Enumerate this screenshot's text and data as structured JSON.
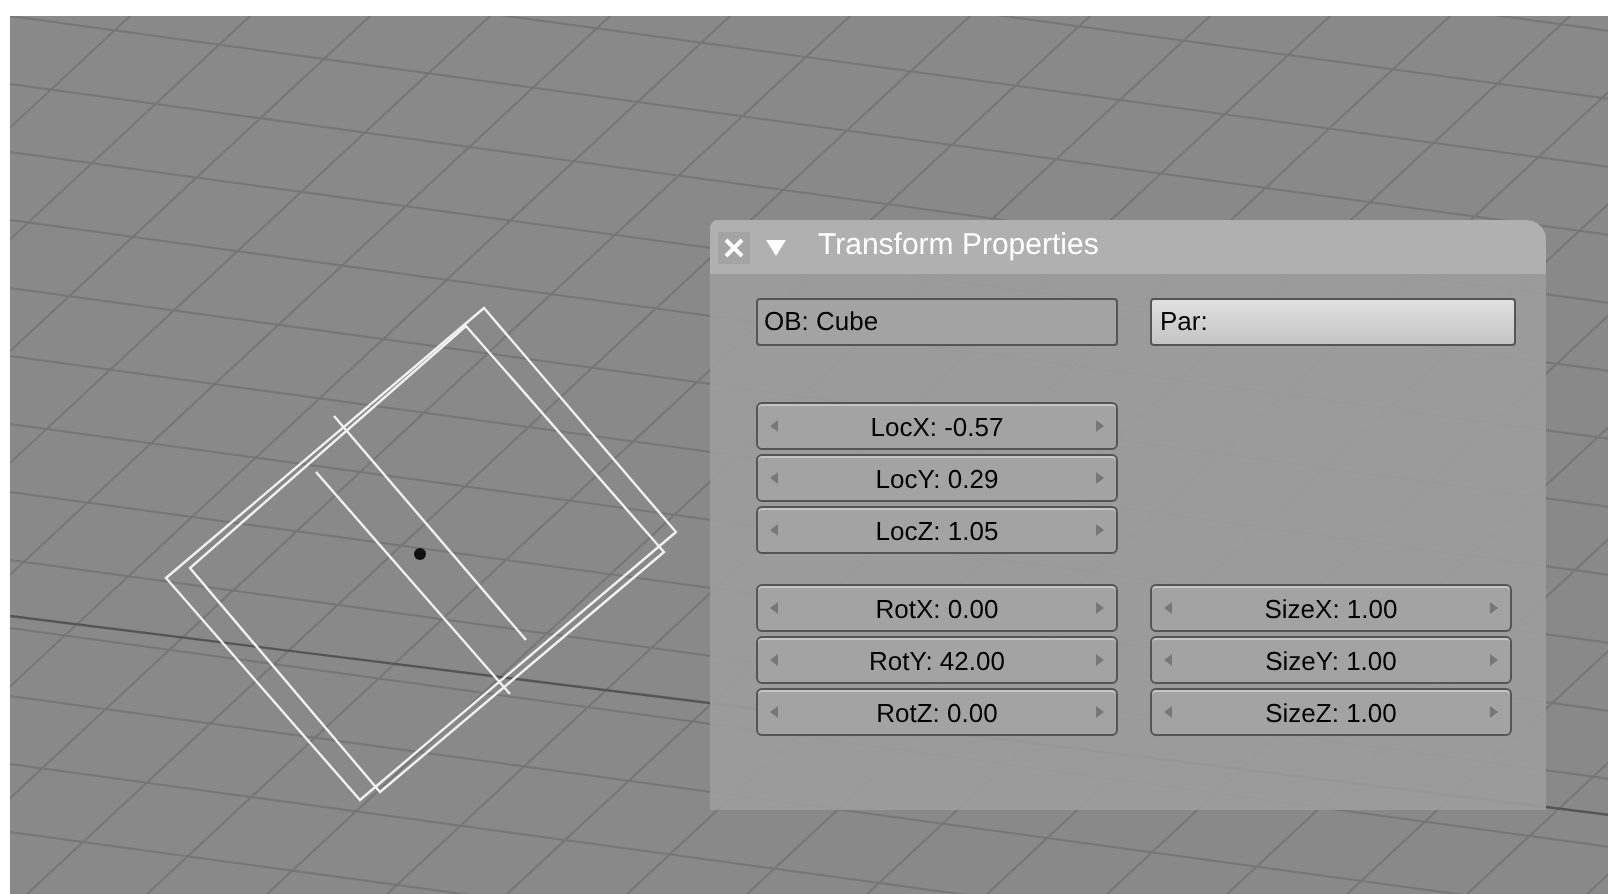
{
  "panel": {
    "title": "Transform Properties",
    "object_field": "OB: Cube",
    "parent_field": "Par:",
    "location": [
      "LocX: -0.57",
      "LocY: 0.29",
      "LocZ: 1.05"
    ],
    "rotation": [
      "RotX: 0.00",
      "RotY: 42.00",
      "RotZ: 0.00"
    ],
    "size": [
      "SizeX: 1.00",
      "SizeY: 1.00",
      "SizeZ: 1.00"
    ]
  }
}
